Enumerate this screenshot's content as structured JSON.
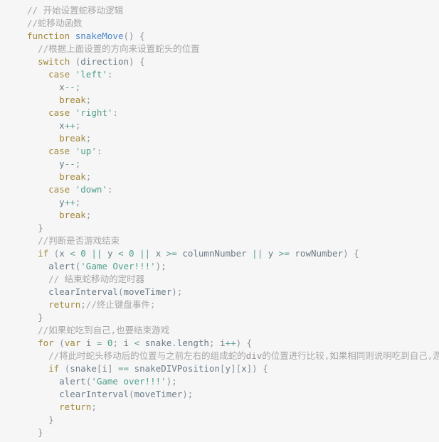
{
  "editor": {
    "background_color": "#f6f6f6",
    "font_size_px": 12.5,
    "line_height_px": 18,
    "language": "javascript",
    "theme_colors": {
      "comment": "#a6a6a6",
      "keyword": "#a1883b",
      "function_name": "#4a86c8",
      "string": "#4f9e8c",
      "number": "#4f9e8c",
      "identifier": "#6b7b88",
      "punctuation": "#8a9199",
      "operator": "#5e9c93"
    }
  },
  "code": {
    "lines": [
      {
        "id": 1,
        "text": "// 开始设置蛇移动逻辑"
      },
      {
        "id": 2,
        "text": "//蛇移动函数"
      },
      {
        "id": 3,
        "text": "function snakeMove() {"
      },
      {
        "id": 4,
        "text": "  //根据上面设置的方向来设置蛇头的位置"
      },
      {
        "id": 5,
        "text": "  switch (direction) {"
      },
      {
        "id": 6,
        "text": "    case 'left':"
      },
      {
        "id": 7,
        "text": "      x--;"
      },
      {
        "id": 8,
        "text": "      break;"
      },
      {
        "id": 9,
        "text": "    case 'right':"
      },
      {
        "id": 10,
        "text": "      x++;"
      },
      {
        "id": 11,
        "text": "      break;"
      },
      {
        "id": 12,
        "text": "    case 'up':"
      },
      {
        "id": 13,
        "text": "      y--;"
      },
      {
        "id": 14,
        "text": "      break;"
      },
      {
        "id": 15,
        "text": "    case 'down':"
      },
      {
        "id": 16,
        "text": "      y++;"
      },
      {
        "id": 17,
        "text": "      break;"
      },
      {
        "id": 18,
        "text": "  }"
      },
      {
        "id": 19,
        "text": "  //判断是否游戏结束"
      },
      {
        "id": 20,
        "text": "  if (x < 0 || y < 0 || x >= columnNumber || y >= rowNumber) {"
      },
      {
        "id": 21,
        "text": "    alert('Game Over!!!');"
      },
      {
        "id": 22,
        "text": "    // 结束蛇移动的定时器"
      },
      {
        "id": 23,
        "text": "    clearInterval(moveTimer);"
      },
      {
        "id": 24,
        "text": "    return;//终止键盘事件;"
      },
      {
        "id": 25,
        "text": "  }"
      },
      {
        "id": 26,
        "text": "  //如果蛇吃到自己,也要结束游戏"
      },
      {
        "id": 27,
        "text": "  for (var i = 0; i < snake.length; i++) {"
      },
      {
        "id": 28,
        "text": "    //将此时蛇头移动后的位置与之前左右的组成蛇的div的位置进行比较,如果相同则说明吃到自己,游戏结"
      },
      {
        "id": 29,
        "text": "    if (snake[i] == snakeDIVPosition[y][x]) {"
      },
      {
        "id": 30,
        "text": "      alert('Game over!!!');"
      },
      {
        "id": 31,
        "text": "      clearInterval(moveTimer);"
      },
      {
        "id": 32,
        "text": "      return;"
      },
      {
        "id": 33,
        "text": "    }"
      },
      {
        "id": 34,
        "text": "  }"
      }
    ],
    "tokens": [
      [
        {
          "t": "comment",
          "v": "// 开始设置蛇移动逻辑"
        }
      ],
      [
        {
          "t": "comment",
          "v": "//蛇移动函数"
        }
      ],
      [
        {
          "t": "keyword",
          "v": "function"
        },
        {
          "t": "plain",
          "v": " "
        },
        {
          "t": "function",
          "v": "snakeMove"
        },
        {
          "t": "punct",
          "v": "() {"
        }
      ],
      [
        {
          "t": "plain",
          "v": "  "
        },
        {
          "t": "comment",
          "v": "//根据上面设置的方向来设置蛇头的位置"
        }
      ],
      [
        {
          "t": "plain",
          "v": "  "
        },
        {
          "t": "keyword",
          "v": "switch"
        },
        {
          "t": "punct",
          "v": " ("
        },
        {
          "t": "ident",
          "v": "direction"
        },
        {
          "t": "punct",
          "v": ") {"
        }
      ],
      [
        {
          "t": "plain",
          "v": "    "
        },
        {
          "t": "keyword",
          "v": "case"
        },
        {
          "t": "plain",
          "v": " "
        },
        {
          "t": "string",
          "v": "'left'"
        },
        {
          "t": "punct",
          "v": ":"
        }
      ],
      [
        {
          "t": "plain",
          "v": "      "
        },
        {
          "t": "ident",
          "v": "x"
        },
        {
          "t": "operator",
          "v": "--"
        },
        {
          "t": "punct",
          "v": ";"
        }
      ],
      [
        {
          "t": "plain",
          "v": "      "
        },
        {
          "t": "keyword",
          "v": "break"
        },
        {
          "t": "punct",
          "v": ";"
        }
      ],
      [
        {
          "t": "plain",
          "v": "    "
        },
        {
          "t": "keyword",
          "v": "case"
        },
        {
          "t": "plain",
          "v": " "
        },
        {
          "t": "string",
          "v": "'right'"
        },
        {
          "t": "punct",
          "v": ":"
        }
      ],
      [
        {
          "t": "plain",
          "v": "      "
        },
        {
          "t": "ident",
          "v": "x"
        },
        {
          "t": "operator",
          "v": "++"
        },
        {
          "t": "punct",
          "v": ";"
        }
      ],
      [
        {
          "t": "plain",
          "v": "      "
        },
        {
          "t": "keyword",
          "v": "break"
        },
        {
          "t": "punct",
          "v": ";"
        }
      ],
      [
        {
          "t": "plain",
          "v": "    "
        },
        {
          "t": "keyword",
          "v": "case"
        },
        {
          "t": "plain",
          "v": " "
        },
        {
          "t": "string",
          "v": "'up'"
        },
        {
          "t": "punct",
          "v": ":"
        }
      ],
      [
        {
          "t": "plain",
          "v": "      "
        },
        {
          "t": "ident",
          "v": "y"
        },
        {
          "t": "operator",
          "v": "--"
        },
        {
          "t": "punct",
          "v": ";"
        }
      ],
      [
        {
          "t": "plain",
          "v": "      "
        },
        {
          "t": "keyword",
          "v": "break"
        },
        {
          "t": "punct",
          "v": ";"
        }
      ],
      [
        {
          "t": "plain",
          "v": "    "
        },
        {
          "t": "keyword",
          "v": "case"
        },
        {
          "t": "plain",
          "v": " "
        },
        {
          "t": "string",
          "v": "'down'"
        },
        {
          "t": "punct",
          "v": ":"
        }
      ],
      [
        {
          "t": "plain",
          "v": "      "
        },
        {
          "t": "ident",
          "v": "y"
        },
        {
          "t": "operator",
          "v": "++"
        },
        {
          "t": "punct",
          "v": ";"
        }
      ],
      [
        {
          "t": "plain",
          "v": "      "
        },
        {
          "t": "keyword",
          "v": "break"
        },
        {
          "t": "punct",
          "v": ";"
        }
      ],
      [
        {
          "t": "plain",
          "v": "  "
        },
        {
          "t": "brace",
          "v": "}"
        }
      ],
      [
        {
          "t": "plain",
          "v": "  "
        },
        {
          "t": "comment",
          "v": "//判断是否游戏结束"
        }
      ],
      [
        {
          "t": "plain",
          "v": "  "
        },
        {
          "t": "keyword",
          "v": "if"
        },
        {
          "t": "punct",
          "v": " ("
        },
        {
          "t": "ident",
          "v": "x"
        },
        {
          "t": "operator",
          "v": " < "
        },
        {
          "t": "number",
          "v": "0"
        },
        {
          "t": "operator",
          "v": " || "
        },
        {
          "t": "ident",
          "v": "y"
        },
        {
          "t": "operator",
          "v": " < "
        },
        {
          "t": "number",
          "v": "0"
        },
        {
          "t": "operator",
          "v": " || "
        },
        {
          "t": "ident",
          "v": "x"
        },
        {
          "t": "operator",
          "v": " >= "
        },
        {
          "t": "ident",
          "v": "columnNumber"
        },
        {
          "t": "operator",
          "v": " || "
        },
        {
          "t": "ident",
          "v": "y"
        },
        {
          "t": "operator",
          "v": " >= "
        },
        {
          "t": "ident",
          "v": "rowNumber"
        },
        {
          "t": "punct",
          "v": ") {"
        }
      ],
      [
        {
          "t": "plain",
          "v": "    "
        },
        {
          "t": "ident",
          "v": "alert"
        },
        {
          "t": "punct",
          "v": "("
        },
        {
          "t": "string",
          "v": "'Game Over!!!'"
        },
        {
          "t": "punct",
          "v": ");"
        }
      ],
      [
        {
          "t": "plain",
          "v": "    "
        },
        {
          "t": "comment",
          "v": "// 结束蛇移动的定时器"
        }
      ],
      [
        {
          "t": "plain",
          "v": "    "
        },
        {
          "t": "ident",
          "v": "clearInterval"
        },
        {
          "t": "punct",
          "v": "("
        },
        {
          "t": "ident",
          "v": "moveTimer"
        },
        {
          "t": "punct",
          "v": ");"
        }
      ],
      [
        {
          "t": "plain",
          "v": "    "
        },
        {
          "t": "keyword",
          "v": "return"
        },
        {
          "t": "punct",
          "v": ";"
        },
        {
          "t": "comment",
          "v": "//终止键盘事件;"
        }
      ],
      [
        {
          "t": "plain",
          "v": "  "
        },
        {
          "t": "brace",
          "v": "}"
        }
      ],
      [
        {
          "t": "plain",
          "v": "  "
        },
        {
          "t": "comment",
          "v": "//如果蛇吃到自己,也要结束游戏"
        }
      ],
      [
        {
          "t": "plain",
          "v": "  "
        },
        {
          "t": "keyword",
          "v": "for"
        },
        {
          "t": "punct",
          "v": " ("
        },
        {
          "t": "keyword",
          "v": "var"
        },
        {
          "t": "plain",
          "v": " "
        },
        {
          "t": "ident",
          "v": "i"
        },
        {
          "t": "operator",
          "v": " = "
        },
        {
          "t": "number",
          "v": "0"
        },
        {
          "t": "punct",
          "v": "; "
        },
        {
          "t": "ident",
          "v": "i"
        },
        {
          "t": "operator",
          "v": " < "
        },
        {
          "t": "ident",
          "v": "snake"
        },
        {
          "t": "punct",
          "v": "."
        },
        {
          "t": "ident",
          "v": "length"
        },
        {
          "t": "punct",
          "v": "; "
        },
        {
          "t": "ident",
          "v": "i"
        },
        {
          "t": "operator",
          "v": "++"
        },
        {
          "t": "punct",
          "v": ") {"
        }
      ],
      [
        {
          "t": "plain",
          "v": "    "
        },
        {
          "t": "comment",
          "v": "//将此时蛇头移动后的位置与之前左右的组成蛇的"
        },
        {
          "t": "cjk-embed",
          "v": "div"
        },
        {
          "t": "comment",
          "v": "的位置进行比较,如果相同则说明吃到自己,游戏结"
        }
      ],
      [
        {
          "t": "plain",
          "v": "    "
        },
        {
          "t": "keyword",
          "v": "if"
        },
        {
          "t": "punct",
          "v": " ("
        },
        {
          "t": "ident",
          "v": "snake"
        },
        {
          "t": "punct",
          "v": "["
        },
        {
          "t": "ident",
          "v": "i"
        },
        {
          "t": "punct",
          "v": "]"
        },
        {
          "t": "operator",
          "v": " == "
        },
        {
          "t": "ident",
          "v": "snakeDIVPosition"
        },
        {
          "t": "punct",
          "v": "["
        },
        {
          "t": "ident",
          "v": "y"
        },
        {
          "t": "punct",
          "v": "]["
        },
        {
          "t": "ident",
          "v": "x"
        },
        {
          "t": "punct",
          "v": "]) {"
        }
      ],
      [
        {
          "t": "plain",
          "v": "      "
        },
        {
          "t": "ident",
          "v": "alert"
        },
        {
          "t": "punct",
          "v": "("
        },
        {
          "t": "string",
          "v": "'Game over!!!'"
        },
        {
          "t": "punct",
          "v": ");"
        }
      ],
      [
        {
          "t": "plain",
          "v": "      "
        },
        {
          "t": "ident",
          "v": "clearInterval"
        },
        {
          "t": "punct",
          "v": "("
        },
        {
          "t": "ident",
          "v": "moveTimer"
        },
        {
          "t": "punct",
          "v": ");"
        }
      ],
      [
        {
          "t": "plain",
          "v": "      "
        },
        {
          "t": "keyword",
          "v": "return"
        },
        {
          "t": "punct",
          "v": ";"
        }
      ],
      [
        {
          "t": "plain",
          "v": "    "
        },
        {
          "t": "brace",
          "v": "}"
        }
      ],
      [
        {
          "t": "plain",
          "v": "  "
        },
        {
          "t": "brace",
          "v": "}"
        }
      ]
    ]
  }
}
